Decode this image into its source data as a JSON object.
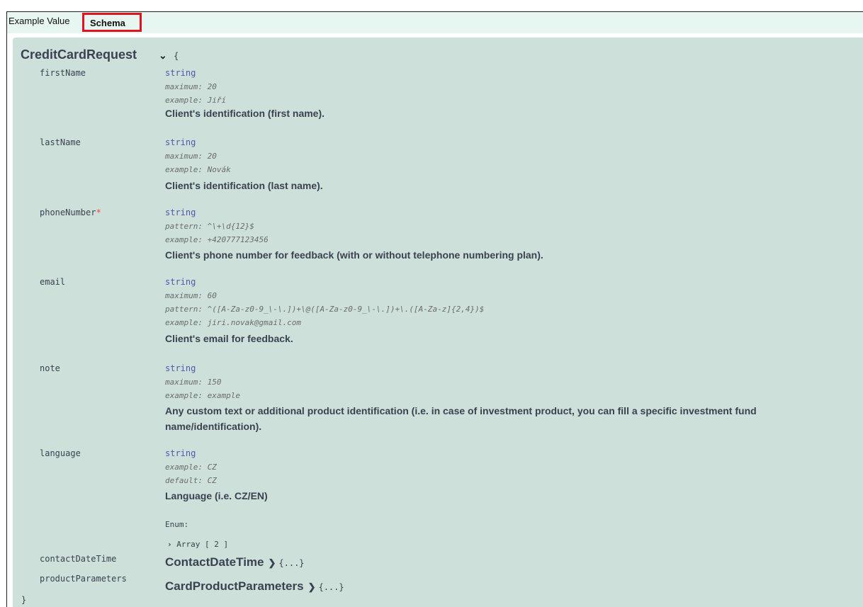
{
  "tabs": {
    "example_value": "Example Value",
    "schema": "Schema"
  },
  "model": {
    "title": "CreditCardRequest",
    "open_brace": "{",
    "close_brace": "}",
    "properties": [
      {
        "name": "firstName",
        "required": false,
        "type": "string",
        "meta": [
          "maximum: 20",
          "example: Jiří"
        ],
        "description": "Client's identification (first name)."
      },
      {
        "name": "lastName",
        "required": false,
        "type": "string",
        "meta": [
          "maximum: 20",
          "example: Novák"
        ],
        "description": "Client's identification (last name)."
      },
      {
        "name": "phoneNumber",
        "required": true,
        "required_mark": "*",
        "type": "string",
        "meta": [
          "pattern: ^\\+\\d{12}$",
          "example: +420777123456"
        ],
        "description": "Client's phone number for feedback (with or without telephone numbering plan)."
      },
      {
        "name": "email",
        "required": false,
        "type": "string",
        "meta": [
          "maximum: 60",
          "pattern: ^([A-Za-z0-9_\\-\\.])+\\@([A-Za-z0-9_\\-\\.])+\\.([A-Za-z]{2,4})$",
          "example: jiri.novak@gmail.com"
        ],
        "description": "Client's email for feedback."
      },
      {
        "name": "note",
        "required": false,
        "type": "string",
        "meta": [
          "maximum: 150",
          "example: example"
        ],
        "description_line1": "Any custom text or additional product identification (i.e. in case of investment product, you can fill a specific investment fund",
        "description_line2": "name/identification)."
      },
      {
        "name": "language",
        "required": false,
        "type": "string",
        "meta": [
          "example: CZ",
          "default: CZ"
        ],
        "description": "Language (i.e. CZ/EN)",
        "enum_label": "Enum:",
        "enum_toggle": "Array [ 2 ]"
      },
      {
        "name": "contactDateTime",
        "ref": "ContactDateTime",
        "collapsed": "{...}"
      },
      {
        "name": "productParameters",
        "ref": "CardProductParameters",
        "collapsed": "{...}"
      }
    ]
  },
  "colors": {
    "model_bg": "#cde0d9",
    "tab_bar_bg": "#e8f6f2",
    "schema_highlight": "#e0141e",
    "type_color": "#5555aa",
    "required_color": "#f93e3e"
  }
}
